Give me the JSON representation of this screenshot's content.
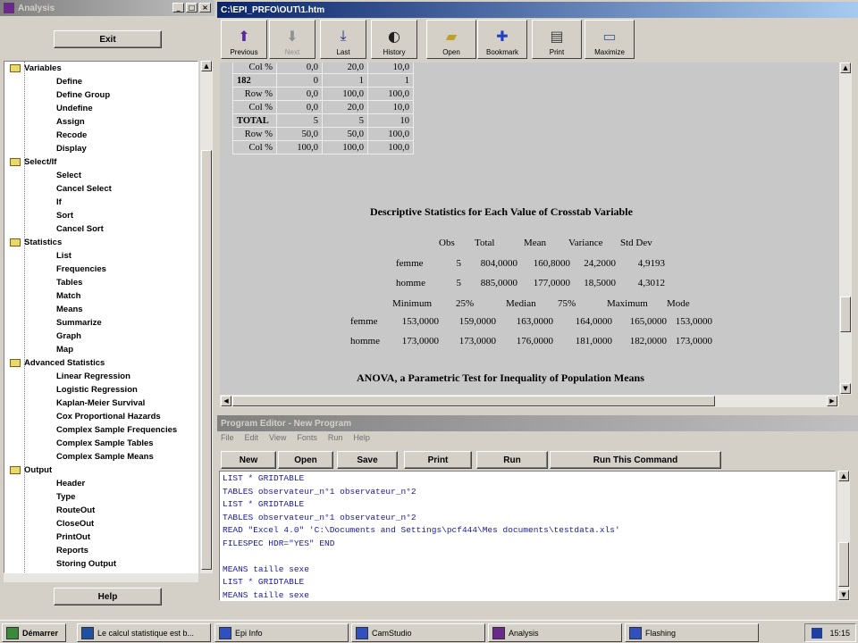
{
  "left_panel": {
    "title": "Analysis",
    "exit_label": "Exit",
    "help_label": "Help",
    "tree": [
      {
        "type": "group",
        "label": "Variables"
      },
      {
        "type": "item",
        "label": "Define"
      },
      {
        "type": "item",
        "label": "Define Group"
      },
      {
        "type": "item",
        "label": "Undefine"
      },
      {
        "type": "item",
        "label": "Assign"
      },
      {
        "type": "item",
        "label": "Recode"
      },
      {
        "type": "item",
        "label": "Display"
      },
      {
        "type": "group",
        "label": "Select/If"
      },
      {
        "type": "item",
        "label": "Select"
      },
      {
        "type": "item",
        "label": "Cancel Select"
      },
      {
        "type": "item",
        "label": "If"
      },
      {
        "type": "item",
        "label": "Sort"
      },
      {
        "type": "item",
        "label": "Cancel Sort"
      },
      {
        "type": "group",
        "label": "Statistics"
      },
      {
        "type": "item",
        "label": "List"
      },
      {
        "type": "item",
        "label": "Frequencies"
      },
      {
        "type": "item",
        "label": "Tables"
      },
      {
        "type": "item",
        "label": "Match"
      },
      {
        "type": "item",
        "label": "Means"
      },
      {
        "type": "item",
        "label": "Summarize"
      },
      {
        "type": "item",
        "label": "Graph"
      },
      {
        "type": "item",
        "label": "Map"
      },
      {
        "type": "group",
        "label": "Advanced Statistics"
      },
      {
        "type": "item",
        "label": "Linear Regression"
      },
      {
        "type": "item",
        "label": "Logistic Regression"
      },
      {
        "type": "item",
        "label": "Kaplan-Meier Survival"
      },
      {
        "type": "item",
        "label": "Cox Proportional Hazards"
      },
      {
        "type": "item",
        "label": "Complex Sample Frequencies"
      },
      {
        "type": "item",
        "label": "Complex Sample Tables"
      },
      {
        "type": "item",
        "label": "Complex Sample Means"
      },
      {
        "type": "group",
        "label": "Output"
      },
      {
        "type": "item",
        "label": "Header"
      },
      {
        "type": "item",
        "label": "Type"
      },
      {
        "type": "item",
        "label": "RouteOut"
      },
      {
        "type": "item",
        "label": "CloseOut"
      },
      {
        "type": "item",
        "label": "PrintOut"
      },
      {
        "type": "item",
        "label": "Reports"
      },
      {
        "type": "item",
        "label": "Storing Output"
      }
    ]
  },
  "output_window": {
    "title": "C:\\EPI_PRFO\\OUT\\1.htm",
    "toolbar": [
      {
        "label": "Previous",
        "icon": "arrow-up-icon",
        "enabled": true
      },
      {
        "label": "Next",
        "icon": "arrow-down-icon",
        "enabled": false
      },
      {
        "label": "Last",
        "icon": "last-icon",
        "enabled": true
      },
      {
        "label": "History",
        "icon": "history-icon",
        "enabled": true
      },
      {
        "label": "Open",
        "icon": "folder-open-icon",
        "enabled": true
      },
      {
        "label": "Bookmark",
        "icon": "bookmark-icon",
        "enabled": true
      },
      {
        "label": "Print",
        "icon": "printer-icon",
        "enabled": true
      },
      {
        "label": "Maximize",
        "icon": "maximize-icon",
        "enabled": true
      }
    ],
    "crosstab_rows": [
      [
        "Col %",
        "0,0",
        "20,0",
        "10,0"
      ],
      [
        "182",
        "0",
        "1",
        "1"
      ],
      [
        "Row %",
        "0,0",
        "100,0",
        "100,0"
      ],
      [
        "Col %",
        "0,0",
        "20,0",
        "10,0"
      ],
      [
        "TOTAL",
        "5",
        "5",
        "10"
      ],
      [
        "Row %",
        "50,0",
        "50,0",
        "100,0"
      ],
      [
        "Col %",
        "100,0",
        "100,0",
        "100,0"
      ]
    ],
    "desc_title": "Descriptive Statistics for Each Value of Crosstab Variable",
    "desc_header1": [
      "Obs",
      "Total",
      "Mean",
      "Variance",
      "Std Dev"
    ],
    "desc_rows1": [
      {
        "label": "femme",
        "values": [
          "5",
          "804,0000",
          "160,8000",
          "24,2000",
          "4,9193"
        ]
      },
      {
        "label": "homme",
        "values": [
          "5",
          "885,0000",
          "177,0000",
          "18,5000",
          "4,3012"
        ]
      }
    ],
    "desc_header2": [
      "Minimum",
      "25%",
      "Median",
      "75%",
      "Maximum",
      "Mode"
    ],
    "desc_rows2": [
      {
        "label": "femme",
        "values": [
          "153,0000",
          "159,0000",
          "163,0000",
          "164,0000",
          "165,0000",
          "153,0000"
        ]
      },
      {
        "label": "homme",
        "values": [
          "173,0000",
          "173,0000",
          "176,0000",
          "181,0000",
          "182,0000",
          "173,0000"
        ]
      }
    ],
    "anova_title": "ANOVA, a Parametric Test for Inequality of Population Means"
  },
  "editor_window": {
    "title": "Program Editor - New Program",
    "menu": [
      "File",
      "Edit",
      "View",
      "Fonts",
      "Run",
      "Help"
    ],
    "buttons": [
      "New",
      "Open",
      "Save",
      "Print",
      "Run",
      "Run This Command"
    ],
    "code_lines": [
      "LIST * GRIDTABLE",
      "TABLES observateur_n°1 observateur_n°2",
      "LIST * GRIDTABLE",
      "TABLES observateur_n°1 observateur_n°2",
      "READ \"Excel 4.0\" 'C:\\Documents and Settings\\pcf444\\Mes documents\\testdata.xls'",
      "FILESPEC HDR=\"YES\" END",
      "",
      "MEANS taille sexe",
      "LIST * GRIDTABLE",
      "MEANS taille sexe"
    ]
  },
  "taskbar": {
    "start_label": "Démarrer",
    "tasks": [
      "Le calcul statistique est b...",
      "Epi Info",
      "CamStudio",
      "Analysis",
      "Flashing"
    ],
    "clock": "15:15"
  }
}
